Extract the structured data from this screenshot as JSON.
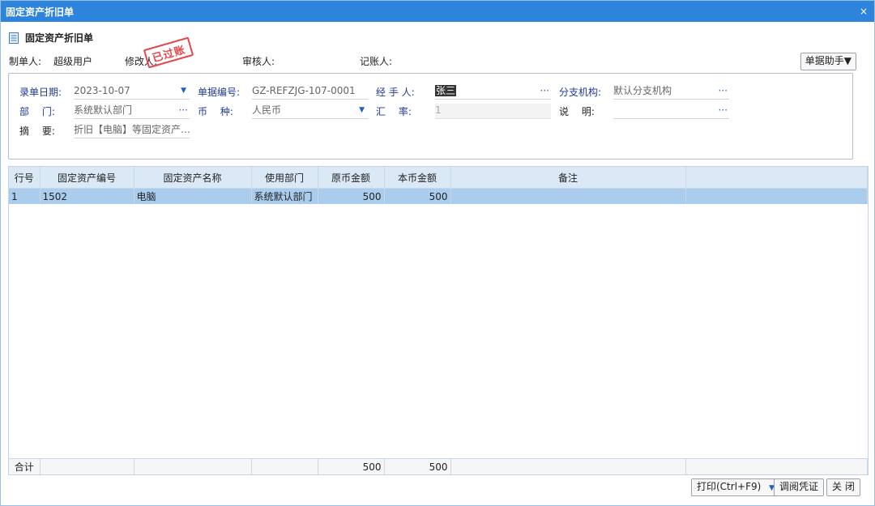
{
  "window": {
    "title": "固定资产折旧单",
    "close_glyph": "×"
  },
  "heading": {
    "title": "固定资产折旧单",
    "icon": "document-icon"
  },
  "people": {
    "creator_label": "制单人:",
    "creator_value": "超级用户",
    "modifier_label": "修改人:",
    "auditor_label": "审核人:",
    "poster_label": "记账人:"
  },
  "stamp": {
    "text": "已过账",
    "color": "#e0353a"
  },
  "helper": {
    "label": "单据助手▼"
  },
  "form": {
    "date_label": "录单日期:",
    "date_value": "2023-10-07",
    "docno_label": "单据编号:",
    "docno_value": "GZ-REFZJG-107-0001",
    "handler_label": "经 手 人:",
    "handler_value": "张三",
    "branch_label": "分支机构:",
    "branch_value": "默认分支机构",
    "dept_label": "部　 门:",
    "dept_value": "系统默认部门",
    "currency_label": "币　 种:",
    "currency_value": "人民币",
    "rate_label": "汇　 率:",
    "rate_value": "1",
    "note_label": "说　 明:",
    "note_value": "",
    "summary_label": "摘　 要:",
    "summary_value": "折旧【电脑】等固定资产…",
    "ellipsis": "···",
    "dropdown": "▼"
  },
  "table": {
    "columns": [
      "行号",
      "固定资产编号",
      "固定资产名称",
      "使用部门",
      "原币金额",
      "本币金额",
      "备注",
      ""
    ],
    "rows": [
      [
        "1",
        "1502",
        "电脑",
        "系统默认部门",
        "500",
        "500",
        "",
        ""
      ]
    ],
    "totals": [
      "合计",
      "",
      "",
      "",
      "500",
      "500",
      "",
      ""
    ]
  },
  "buttons": {
    "print": "打印(Ctrl+F9)",
    "print_dd": "▼",
    "voucher": "调阅凭证",
    "close": "关 闭"
  },
  "colors": {
    "titlebar": "#2d84dc",
    "selected_row": "#aacdee",
    "label_blue": "#1e3a9a"
  }
}
